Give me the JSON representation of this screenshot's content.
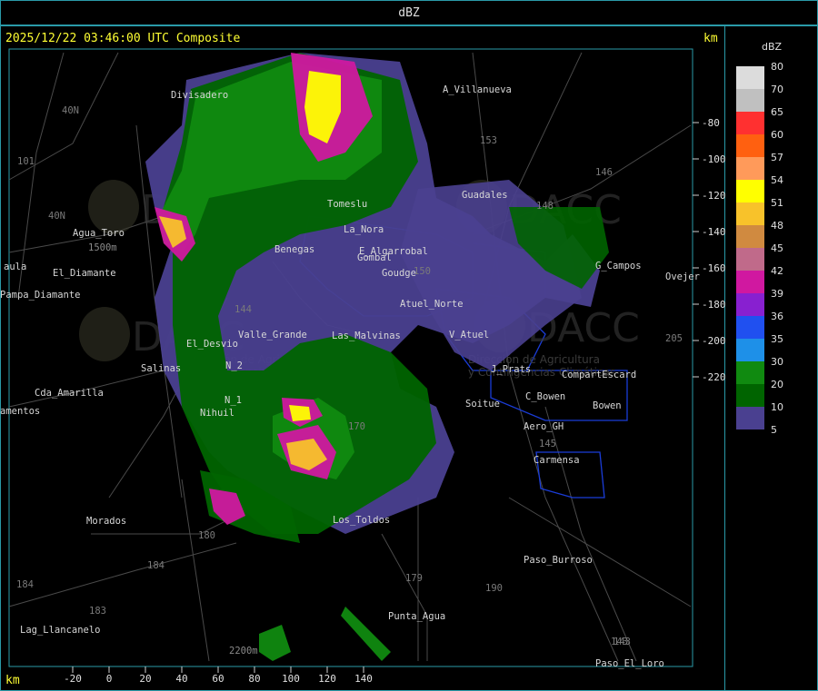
{
  "product_title": "dBZ",
  "info_line": "2025/12/22 03:46:00 UTC Composite",
  "units": {
    "top_right": "km",
    "bottom_left": "km"
  },
  "legend": {
    "title": "dBZ",
    "levels": [
      {
        "value": "80",
        "color": "#dcdcdc"
      },
      {
        "value": "70",
        "color": "#c0c0c0"
      },
      {
        "value": "65",
        "color": "#ff3030"
      },
      {
        "value": "60",
        "color": "#ff6010"
      },
      {
        "value": "57",
        "color": "#ff9a5a"
      },
      {
        "value": "54",
        "color": "#ffff00"
      },
      {
        "value": "51",
        "color": "#f8c22a"
      },
      {
        "value": "48",
        "color": "#d08a40"
      },
      {
        "value": "45",
        "color": "#c06a8a"
      },
      {
        "value": "42",
        "color": "#d018a0"
      },
      {
        "value": "39",
        "color": "#8820d0"
      },
      {
        "value": "36",
        "color": "#2050f0"
      },
      {
        "value": "35",
        "color": "#1e90e8"
      },
      {
        "value": "30",
        "color": "#108a10"
      },
      {
        "value": "20",
        "color": "#006400"
      },
      {
        "value": "10",
        "color": "#4a4090"
      },
      {
        "value": "5",
        "color": null
      }
    ]
  },
  "axes": {
    "x_ticks": [
      "-20",
      "0",
      "20",
      "40",
      "60",
      "80",
      "100",
      "120",
      "140"
    ],
    "y_ticks": [
      "-80",
      "-100",
      "-120",
      "-140",
      "-160",
      "-180",
      "-200",
      "-220"
    ]
  },
  "places": [
    "Divisadero",
    "A_Villanueva",
    "Guadales",
    "Tomeslu",
    "La_Nora",
    "E_Algarrobal",
    "Gombal",
    "Goudge",
    "G_Campos",
    "Ovejer",
    "Agua_Toro",
    "El_Diamante",
    "Pampa_Diamante",
    "El_Desvio",
    "Valle_Grande",
    "Las_Malvinas",
    "Atuel_Norte",
    "V_Atuel",
    "Salinas",
    "N_2",
    "N_1",
    "Cda_Amarilla",
    "Nihuil",
    "Soitue",
    "J_Prats",
    "CompartEscard",
    "C_Bowen",
    "Bowen",
    "Aero_GH",
    "Carmensa",
    "Morados",
    "Los_Toldos",
    "Paso_Burroso",
    "Punta_Agua",
    "Lag_Llancanelo",
    "Paso_El_Loro",
    "aula",
    "amentos",
    "Benegas"
  ],
  "route_numbers": [
    "40N",
    "40N",
    "101",
    "153",
    "146",
    "148",
    "144",
    "143",
    "205",
    "180",
    "184",
    "184",
    "183",
    "179",
    "190",
    "170",
    "145",
    "150",
    "143"
  ],
  "elevation_labels": [
    "1500m",
    "2200m"
  ],
  "watermark": {
    "brand": "DACC",
    "line1": "Dirección de Agricultura",
    "line2": "y Contingencias Climáticas"
  }
}
